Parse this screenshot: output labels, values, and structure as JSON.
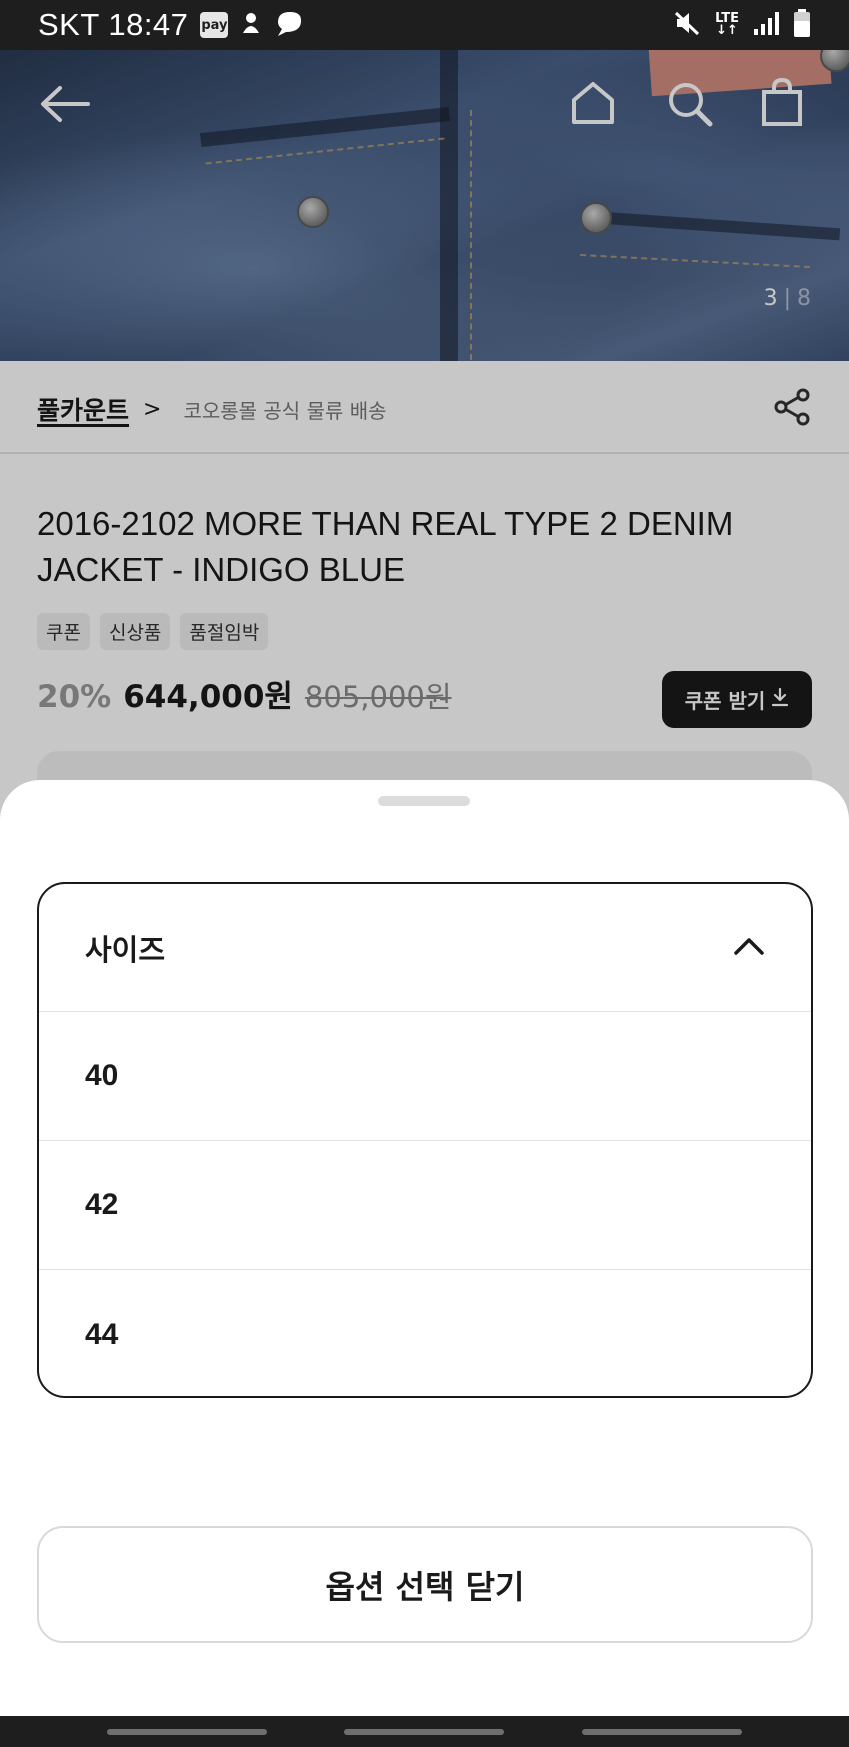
{
  "status_bar": {
    "carrier_time": "SKT 18:47",
    "pay_badge": "pay",
    "lte_label": "LTE"
  },
  "hero": {
    "page_current": "3",
    "page_separator": "|",
    "page_total": "8"
  },
  "brand": {
    "name": "풀카운트",
    "chevron": ">",
    "shipping_note": "코오롱몰 공식 물류 배송"
  },
  "product": {
    "title": "2016-2102 MORE THAN REAL TYPE 2 DENIM JACKET - INDIGO BLUE",
    "badges": [
      "쿠폰",
      "신상품",
      "품절임박"
    ],
    "discount": "20%",
    "price": "644,000원",
    "original_price": "805,000원",
    "coupon_button_label": "쿠폰 받기"
  },
  "sheet": {
    "option_header": "사이즈",
    "options": [
      "40",
      "42",
      "44"
    ],
    "close_label": "옵션 선택 닫기"
  },
  "icons": {
    "back": "back-arrow-icon",
    "home": "home-icon",
    "search": "search-icon",
    "bag": "shopping-bag-icon",
    "share": "share-icon",
    "chevron_up": "chevron-up-icon",
    "download": "download-icon"
  },
  "colors": {
    "primary": "#1a1a1a",
    "muted": "#8a8a8a",
    "status_bar": "#1e1e1e"
  }
}
